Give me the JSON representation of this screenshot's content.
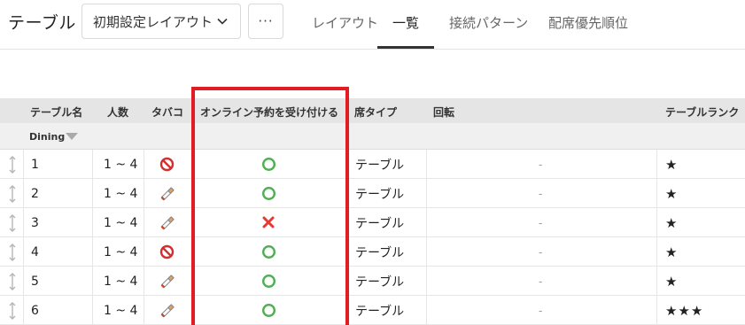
{
  "header": {
    "title": "テーブル",
    "layout_select": {
      "value": "初期設定レイアウト"
    },
    "more_label": "···",
    "tabs": [
      {
        "label": "レイアウト",
        "active": false
      },
      {
        "label": "一覧",
        "active": true
      },
      {
        "label": "接続パターン",
        "active": false
      },
      {
        "label": "配席優先順位",
        "active": false
      }
    ]
  },
  "table": {
    "columns": [
      "テーブル名",
      "人数",
      "タバコ",
      "オンライン予約を受け付ける",
      "席タイプ",
      "回転",
      "テーブルランク"
    ],
    "group": {
      "label": "Dining"
    },
    "rows": [
      {
        "name": "1",
        "capacity": "1 ~ 4",
        "tobacco": "no-smoking-icon",
        "online": "accepted-circle-icon",
        "seat_type": "テーブル",
        "rotation": "-",
        "rank": "★"
      },
      {
        "name": "2",
        "capacity": "1 ~ 4",
        "tobacco": "cigarette-icon",
        "online": "accepted-circle-icon",
        "seat_type": "テーブル",
        "rotation": "-",
        "rank": "★"
      },
      {
        "name": "3",
        "capacity": "1 ~ 4",
        "tobacco": "cigarette-icon",
        "online": "rejected-cross-icon",
        "seat_type": "テーブル",
        "rotation": "-",
        "rank": "★"
      },
      {
        "name": "4",
        "capacity": "1 ~ 4",
        "tobacco": "no-smoking-icon",
        "online": "accepted-circle-icon",
        "seat_type": "テーブル",
        "rotation": "-",
        "rank": "★"
      },
      {
        "name": "5",
        "capacity": "1 ~ 4",
        "tobacco": "cigarette-icon",
        "online": "accepted-circle-icon",
        "seat_type": "テーブル",
        "rotation": "-",
        "rank": "★"
      },
      {
        "name": "6",
        "capacity": "1 ~ 4",
        "tobacco": "cigarette-icon",
        "online": "accepted-circle-icon",
        "seat_type": "テーブル",
        "rotation": "-",
        "rank": "★★★"
      }
    ]
  },
  "colors": {
    "highlight": "#e31b23",
    "accept": "#4caf50",
    "reject": "#e53935",
    "no_smoking": "#d32f2f"
  }
}
